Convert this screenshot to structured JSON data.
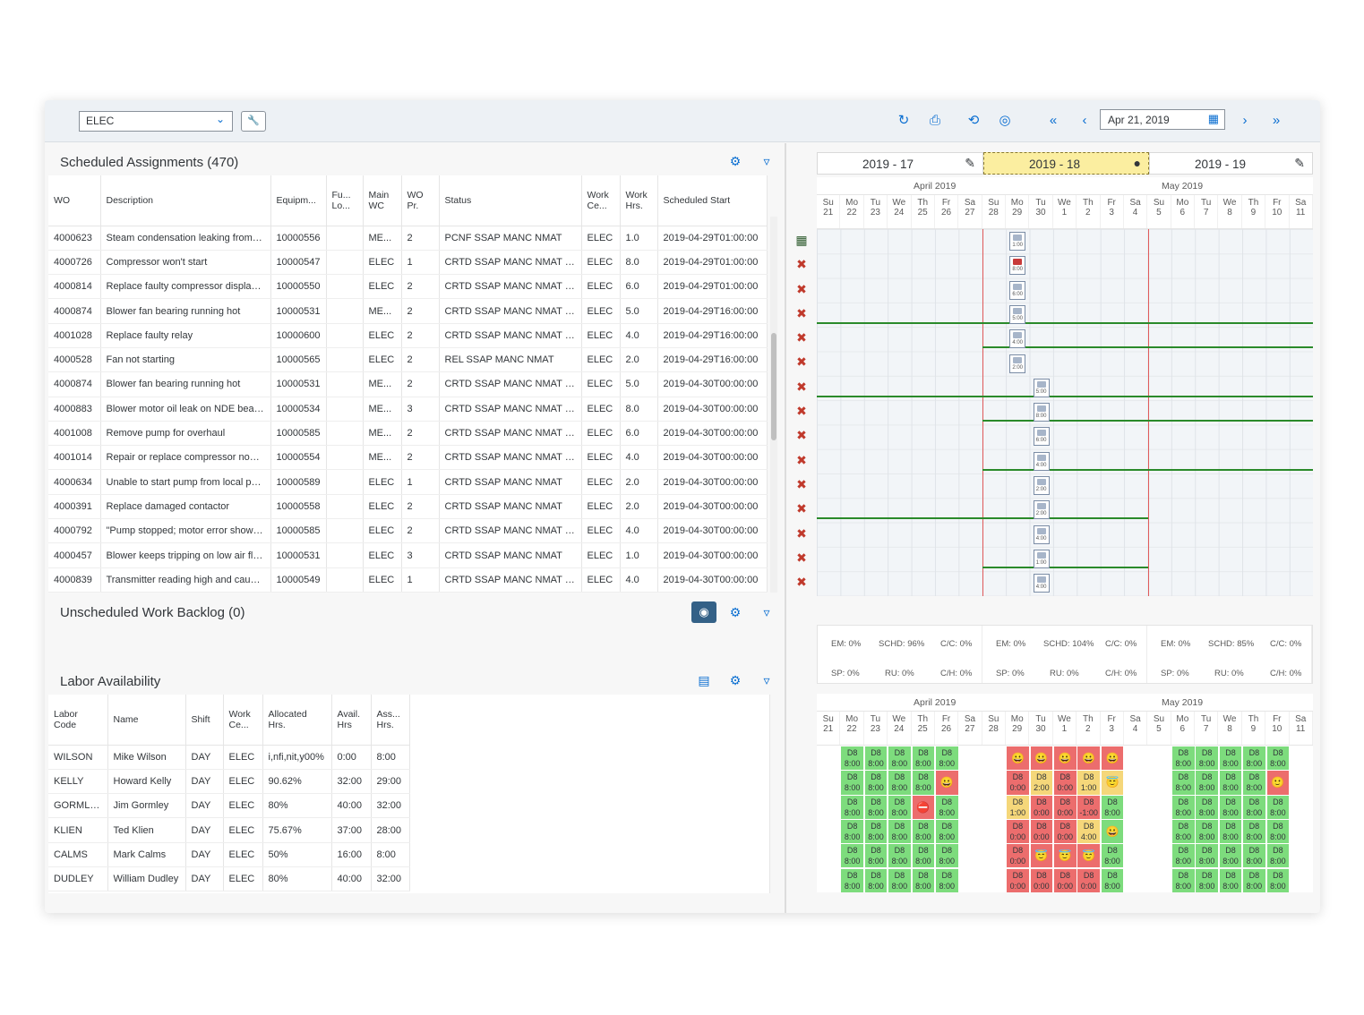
{
  "toolbar": {
    "workcenter": "ELEC",
    "date": "Apr 21, 2019",
    "icons": [
      "refresh-icon",
      "print-icon",
      "undo-icon",
      "target-icon",
      "first-page-icon",
      "prev-icon",
      "next-icon",
      "last-page-icon"
    ]
  },
  "scheduled": {
    "title": "Scheduled Assignments (470)",
    "columns": [
      "WO",
      "Description",
      "Equipm...",
      "Fu... Lo...",
      "Main WC",
      "WO Pr.",
      "Status",
      "Work Ce...",
      "Work Hrs.",
      "Scheduled Start"
    ],
    "rows": [
      [
        "4000623",
        "Steam condensation leaking from d...",
        "10000556",
        "",
        "ME...",
        "2",
        "PCNF SSAP MANC NMAT",
        "ELEC",
        "1.0",
        "2019-04-29T01:00:00"
      ],
      [
        "4000726",
        "Compressor won't start",
        "10000547",
        "",
        "ELEC",
        "1",
        "CRTD SSAP MANC NMAT E...",
        "ELEC",
        "8.0",
        "2019-04-29T01:00:00"
      ],
      [
        "4000814",
        "Replace faulty compressor display ...",
        "10000550",
        "",
        "ELEC",
        "2",
        "CRTD SSAP MANC NMAT E...",
        "ELEC",
        "6.0",
        "2019-04-29T01:00:00"
      ],
      [
        "4000874",
        "Blower fan bearing running hot",
        "10000531",
        "",
        "ME...",
        "2",
        "CRTD SSAP MANC NMAT E...",
        "ELEC",
        "5.0",
        "2019-04-29T16:00:00"
      ],
      [
        "4001028",
        "Replace faulty relay",
        "10000600",
        "",
        "ELEC",
        "2",
        "CRTD SSAP MANC NMAT E...",
        "ELEC",
        "4.0",
        "2019-04-29T16:00:00"
      ],
      [
        "4000528",
        "Fan not starting",
        "10000565",
        "",
        "ELEC",
        "2",
        "REL SSAP MANC NMAT",
        "ELEC",
        "2.0",
        "2019-04-29T16:00:00"
      ],
      [
        "4000874",
        "Blower fan bearing running hot",
        "10000531",
        "",
        "ME...",
        "2",
        "CRTD SSAP MANC NMAT E...",
        "ELEC",
        "5.0",
        "2019-04-30T00:00:00"
      ],
      [
        "4000883",
        "Blower motor oil leak on NDE beari...",
        "10000534",
        "",
        "ME...",
        "3",
        "CRTD SSAP MANC NMAT E...",
        "ELEC",
        "8.0",
        "2019-04-30T00:00:00"
      ],
      [
        "4001008",
        "Remove pump for overhaul",
        "10000585",
        "",
        "ME...",
        "2",
        "CRTD SSAP MANC NMAT E...",
        "ELEC",
        "6.0",
        "2019-04-30T00:00:00"
      ],
      [
        "4001014",
        "Repair or replace compressor non r...",
        "10000554",
        "",
        "ME...",
        "2",
        "CRTD SSAP MANC NMAT E...",
        "ELEC",
        "4.0",
        "2019-04-30T00:00:00"
      ],
      [
        "4000634",
        "Unable to start pump from local pa...",
        "10000589",
        "",
        "ELEC",
        "1",
        "CRTD SSAP MANC NMAT",
        "ELEC",
        "2.0",
        "2019-04-30T00:00:00"
      ],
      [
        "4000391",
        "Replace damaged contactor",
        "10000558",
        "",
        "ELEC",
        "2",
        "CRTD SSAP MANC NMAT",
        "ELEC",
        "2.0",
        "2019-04-30T00:00:00"
      ],
      [
        "4000792",
        "\"Pump stopped; motor error shown...",
        "10000585",
        "",
        "ELEC",
        "2",
        "CRTD SSAP MANC NMAT E...",
        "ELEC",
        "4.0",
        "2019-04-30T00:00:00"
      ],
      [
        "4000457",
        "Blower keeps tripping on low air flow",
        "10000531",
        "",
        "ELEC",
        "3",
        "CRTD SSAP MANC NMAT",
        "ELEC",
        "1.0",
        "2019-04-30T00:00:00"
      ],
      [
        "4000839",
        "Transmitter reading high and causin...",
        "10000549",
        "",
        "ELEC",
        "1",
        "CRTD SSAP MANC NMAT E...",
        "ELEC",
        "4.0",
        "2019-04-30T00:00:00"
      ]
    ]
  },
  "backlog": {
    "title": "Unscheduled Work Backlog (0)"
  },
  "labor": {
    "title": "Labor Availability",
    "columns": [
      "Labor Code",
      "Name",
      "Shift",
      "Work Ce...",
      "Allocated Hrs.",
      "Avail. Hrs",
      "Ass... Hrs."
    ],
    "rows": [
      [
        "WILSON",
        "Mike Wilson",
        "DAY",
        "ELEC",
        "i,nfi,nit,y00%",
        "0:00",
        "8:00"
      ],
      [
        "KELLY",
        "Howard Kelly",
        "DAY",
        "ELEC",
        "90.62%",
        "32:00",
        "29:00"
      ],
      [
        "GORMLEY",
        "Jim Gormley",
        "DAY",
        "ELEC",
        "80%",
        "40:00",
        "32:00"
      ],
      [
        "KLIEN",
        "Ted Klien",
        "DAY",
        "ELEC",
        "75.67%",
        "37:00",
        "28:00"
      ],
      [
        "CALMS",
        "Mark Calms",
        "DAY",
        "ELEC",
        "50%",
        "16:00",
        "8:00"
      ],
      [
        "DUDLEY",
        "William Dudley",
        "DAY",
        "ELEC",
        "80%",
        "40:00",
        "32:00"
      ]
    ]
  },
  "weeks": [
    "2019 - 17",
    "2019 - 18",
    "2019 - 19"
  ],
  "months": [
    "April 2019",
    "May 2019"
  ],
  "days": [
    [
      "Su",
      "21"
    ],
    [
      "Mo",
      "22"
    ],
    [
      "Tu",
      "23"
    ],
    [
      "We",
      "24"
    ],
    [
      "Th",
      "25"
    ],
    [
      "Fr",
      "26"
    ],
    [
      "Sa",
      "27"
    ],
    [
      "Su",
      "28"
    ],
    [
      "Mo",
      "29"
    ],
    [
      "Tu",
      "30"
    ],
    [
      "We",
      "1"
    ],
    [
      "Th",
      "2"
    ],
    [
      "Fr",
      "3"
    ],
    [
      "Sa",
      "4"
    ],
    [
      "Su",
      "5"
    ],
    [
      "Mo",
      "6"
    ],
    [
      "Tu",
      "7"
    ],
    [
      "We",
      "8"
    ],
    [
      "Th",
      "9"
    ],
    [
      "Fr",
      "10"
    ],
    [
      "Sa",
      "11"
    ]
  ],
  "bars": [
    [
      "1:00",
      8,
      0
    ],
    [
      "8:00",
      8,
      1
    ],
    [
      "6:00",
      8,
      2
    ],
    [
      "5:00",
      8,
      3
    ],
    [
      "4:00",
      8,
      4
    ],
    [
      "2:00",
      8,
      5
    ],
    [
      "5:00",
      9,
      6
    ],
    [
      "8:00",
      9,
      7
    ],
    [
      "6:00",
      9,
      8
    ],
    [
      "4:00",
      9,
      9
    ],
    [
      "2:00",
      9,
      10
    ],
    [
      "2:00",
      9,
      11
    ],
    [
      "4:00",
      9,
      12
    ],
    [
      "1:00",
      9,
      13
    ],
    [
      "4:00",
      9,
      14
    ]
  ],
  "kpis": [
    {
      "em": "EM: 0%",
      "schd": "SCHD: 96%",
      "cc": "C/C: 0%",
      "sp": "SP: 0%",
      "ru": "RU: 0%",
      "ch": "C/H: 0%"
    },
    {
      "em": "EM: 0%",
      "schd": "SCHD: 104%",
      "cc": "C/C: 0%",
      "sp": "SP: 0%",
      "ru": "RU: 0%",
      "ch": "C/H: 0%"
    },
    {
      "em": "EM: 0%",
      "schd": "SCHD: 85%",
      "cc": "C/C: 0%",
      "sp": "SP: 0%",
      "ru": "RU: 0%",
      "ch": "C/H: 0%"
    }
  ],
  "avail": [
    [
      "g:D8|8:00",
      "g:D8|8:00",
      "g:D8|8:00",
      "g:D8|8:00",
      "g:D8|8:00",
      "r:😀",
      "r:😀",
      "r:😀",
      "r:😀",
      "r:😀",
      "g:D8|8:00",
      "g:D8|8:00",
      "g:D8|8:00",
      "g:D8|8:00",
      "g:D8|8:00"
    ],
    [
      "g:D8|8:00",
      "g:D8|8:00",
      "g:D8|8:00",
      "g:D8|8:00",
      "r:😀",
      "r:D8|0:00",
      "y:D8|2:00",
      "r:D8|0:00",
      "y:D8|1:00",
      "y:😇",
      "g:D8|8:00",
      "g:D8|8:00",
      "g:D8|8:00",
      "g:D8|8:00",
      "r:🙂"
    ],
    [
      "g:D8|8:00",
      "g:D8|8:00",
      "g:D8|8:00",
      "r:⛔",
      "g:D8|8:00",
      "y:D8|1:00",
      "r:D8|0:00",
      "r:D8|0:00",
      "r:D8|-1:00",
      "g:D8|8:00",
      "g:D8|8:00",
      "g:D8|8:00",
      "g:D8|8:00",
      "g:D8|8:00",
      "g:D8|8:00"
    ],
    [
      "g:D8|8:00",
      "g:D8|8:00",
      "g:D8|8:00",
      "g:D8|8:00",
      "g:D8|8:00",
      "r:D8|0:00",
      "r:D8|0:00",
      "r:D8|0:00",
      "y:D8|4:00",
      "g:😀",
      "g:D8|8:00",
      "g:D8|8:00",
      "g:D8|8:00",
      "g:D8|8:00",
      "g:D8|8:00"
    ],
    [
      "g:D8|8:00",
      "g:D8|8:00",
      "g:D8|8:00",
      "g:D8|8:00",
      "g:D8|8:00",
      "r:D8|0:00",
      "r:😇",
      "r:😇",
      "r:😇",
      "g:D8|8:00",
      "g:D8|8:00",
      "g:D8|8:00",
      "g:D8|8:00",
      "g:D8|8:00",
      "g:D8|8:00"
    ],
    [
      "g:D8|8:00",
      "g:D8|8:00",
      "g:D8|8:00",
      "g:D8|8:00",
      "g:D8|8:00",
      "r:D8|0:00",
      "r:D8|0:00",
      "r:D8|0:00",
      "r:D8|0:00",
      "g:D8|8:00",
      "g:D8|8:00",
      "g:D8|8:00",
      "g:D8|8:00",
      "g:D8|8:00",
      "g:D8|8:00"
    ]
  ]
}
